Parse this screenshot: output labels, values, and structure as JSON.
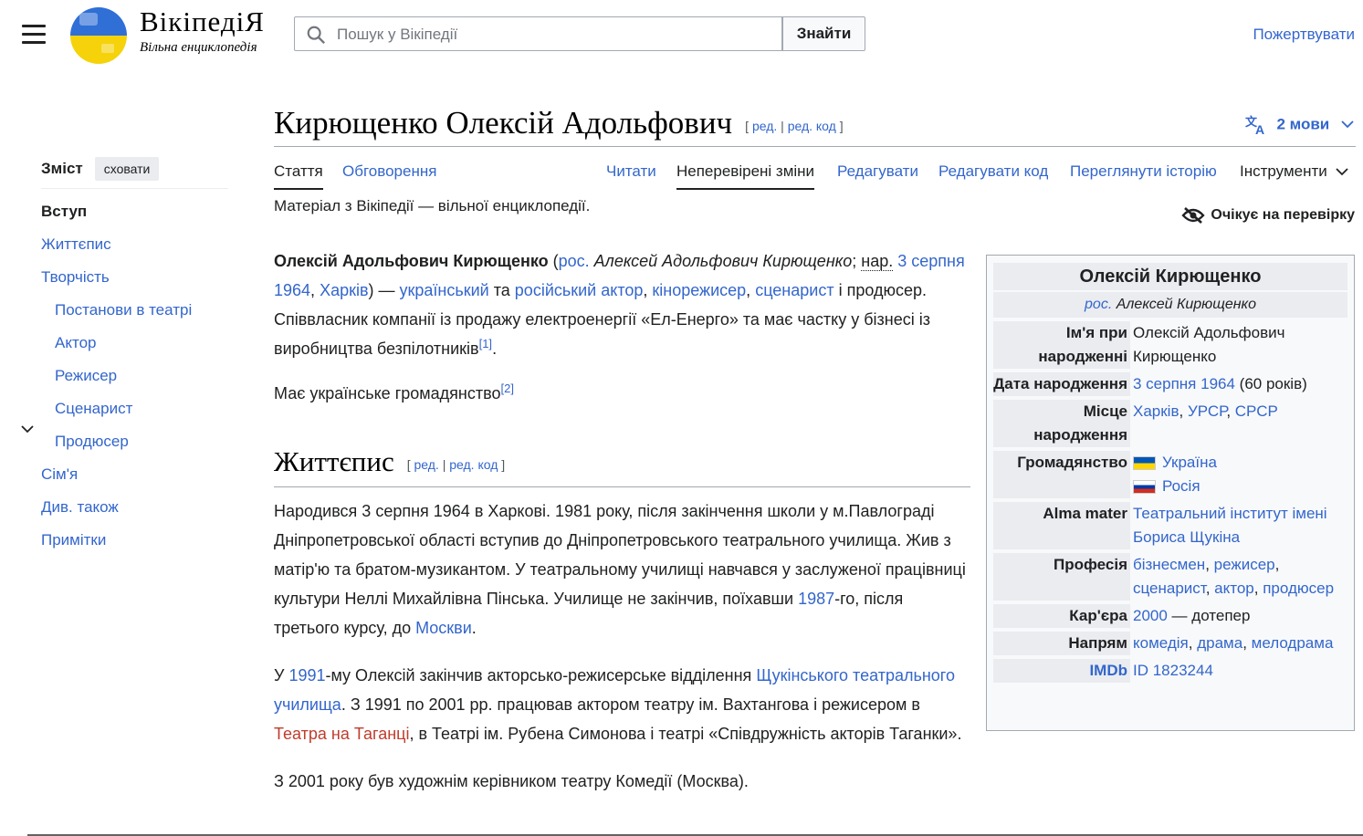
{
  "header": {
    "logo_word": "ВікіпедіЯ",
    "logo_tagline": "Вільна енциклопедія",
    "search_placeholder": "Пошук у Вікіпедії",
    "search_button": "Знайти",
    "donate": "Пожертвувати"
  },
  "toc": {
    "title": "Зміст",
    "hide": "сховати",
    "items": [
      "Вступ",
      "Життєпис",
      "Творчість",
      "Постанови в театрі",
      "Актор",
      "Режисер",
      "Сценарист",
      "Продюсер",
      "Сім'я",
      "Див. також",
      "Примітки"
    ]
  },
  "page": {
    "title": "Кирющенко Олексій Адольфович",
    "edit_open": "[",
    "edit": "ред.",
    "edit_sep": "|",
    "edit_code": "ред. код",
    "edit_close": "]",
    "languages": "2 мови",
    "tagline": "Матеріал з Вікіпедії — вільної енциклопедії.",
    "pending": "Очікує на перевірку"
  },
  "tabs": {
    "article": "Стаття",
    "talk": "Обговорення",
    "read": "Читати",
    "unreviewed": "Неперевірені зміни",
    "edit": "Редагувати",
    "edit_code": "Редагувати код",
    "history": "Переглянути історію",
    "tools": "Інструменти"
  },
  "intro": {
    "p1": {
      "name": "Олексій Адольфович Кирющенко",
      "open": " (",
      "ros": "рос.",
      "ru_name": " Алексей Адольфович Кирющенко",
      "semi": "; ",
      "nar": "нар.",
      "date": "3 серпня 1964",
      "comma1": ", ",
      "city": "Харків",
      "close": ") — ",
      "ukr": "український",
      "ta": " та ",
      "rus_actor": "російський актор",
      "comma2": ", ",
      "director": "кінорежисер",
      "comma3": ", ",
      "writer": "сценарист",
      "rest": " і продюсер. Співвласник компанії із продажу електроенергії «Ел-Енерго» та має частку у бізнесі із виробництва безпілотників",
      "ref1": "[1]",
      "end": "."
    },
    "p2": {
      "text": "Має українське громадянство",
      "ref2": "[2]"
    }
  },
  "section": {
    "title": "Життєпис",
    "p1a": "Народився 3 серпня 1964 в Харкові. 1981 року, після закінчення школи у м.Павлограді Дніпропетровської області вступив до Дніпропетровського театрального училища. Жив з матір'ю та братом-музикантом. У театральному училищі навчався у заслуженої працівниці культури Неллі Михайлівна Пінська. Училище не закінчив, поїхавши ",
    "p1_year": "1987",
    "p1b": "-го, після третього курсу, до ",
    "p1_moscow": "Москви",
    "p1c": ".",
    "p2a": "У ",
    "p2_year": "1991",
    "p2b": "-му Олексій закінчив акторсько-режисерське відділення ",
    "p2_school": "Щукінського театрального училища",
    "p2c": ". З 1991 по 2001 рр. працював актором театру ім. Вахтангова і режисером в ",
    "p2_taganka": "Театра на Таганці",
    "p2d": ", в Театрі ім. Рубена Симонова і театрі «Співдружність акторів Таганки».",
    "p3": "З 2001 року був художнім керівником театру Комедії (Москва)."
  },
  "infobox": {
    "title": "Олексій Кирющенко",
    "sub_ros": "рос.",
    "sub_name": " Алексей Кирющенко",
    "birth_name_label": "Ім'я при народженні",
    "birth_name": "Олексій Адольфович Кирющенко",
    "birth_date_label": "Дата народження",
    "birth_date": "3 серпня 1964",
    "age": " (60 років)",
    "birth_place_label": "Місце народження",
    "place1": "Харків",
    "place2": "УРСР",
    "place3": "СРСР",
    "sep": ", ",
    "citizenship_label": "Громадянство",
    "citizenship1": "Україна",
    "citizenship2": "Росія",
    "alma_label": "Alma mater",
    "alma": "Театральний інститут імені Бориса Щукіна",
    "profession_label": "Професія",
    "prof1": "бізнесмен",
    "prof2": "режисер",
    "prof3": "сценарист",
    "prof4": "актор",
    "prof5": "продюсер",
    "career_label": "Кар'єра",
    "career_year": "2000",
    "career_rest": " — дотепер",
    "direction_label": "Напрям",
    "dir1": "комедія",
    "dir2": "драма",
    "dir3": "мелодрама",
    "imdb_label": "IMDb",
    "imdb": "ID 1823244"
  },
  "colors": {
    "link": "#3366cc",
    "redlink": "#bf3c2c",
    "text": "#202122"
  }
}
